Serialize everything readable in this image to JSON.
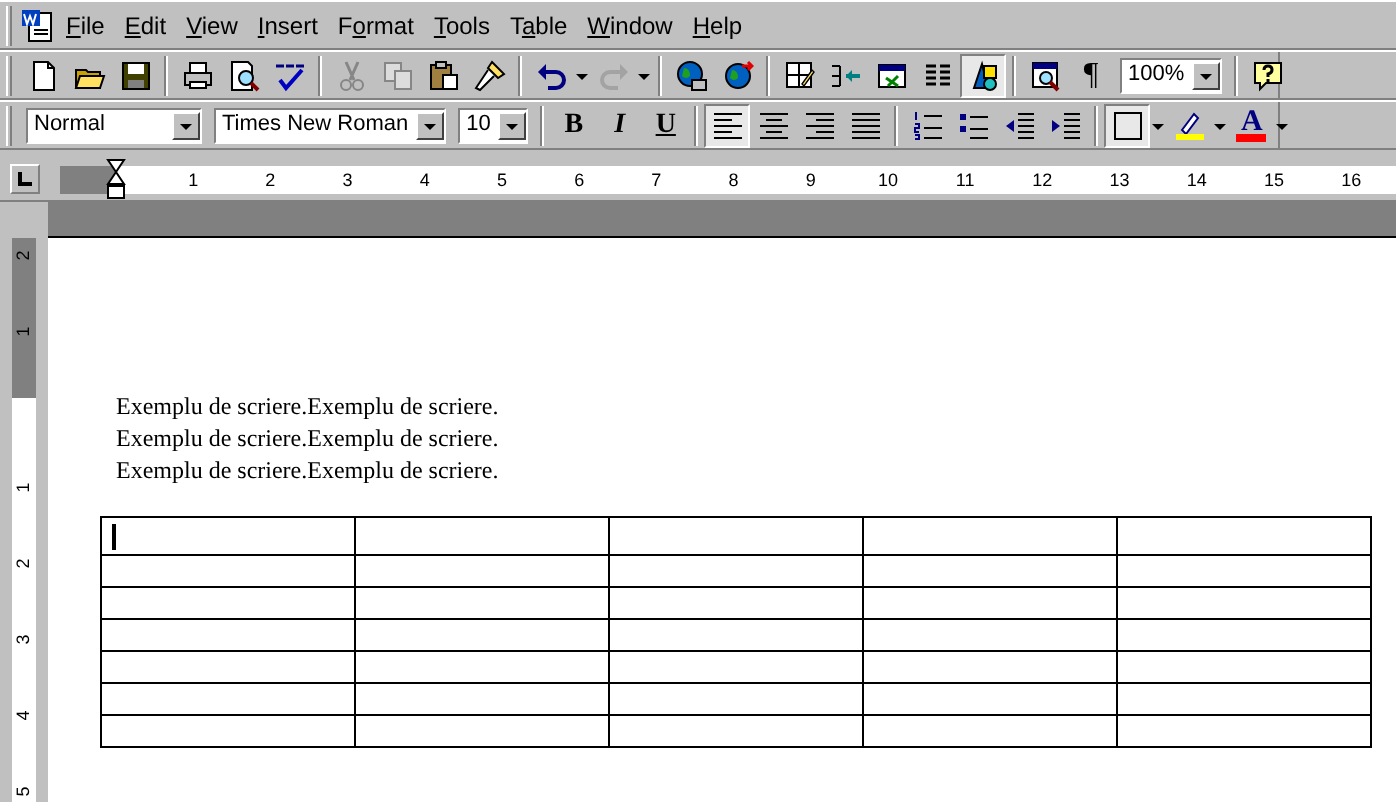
{
  "menu_bar": {
    "items": [
      {
        "access_key": "F",
        "rest": "ile"
      },
      {
        "access_key": "E",
        "rest": "dit"
      },
      {
        "access_key": "V",
        "rest": "iew"
      },
      {
        "access_key": "I",
        "rest": "nsert"
      },
      {
        "before": "F",
        "access_key": "o",
        "rest": "rmat"
      },
      {
        "access_key": "T",
        "rest": "ools"
      },
      {
        "before": "T",
        "access_key": "a",
        "rest": "ble"
      },
      {
        "access_key": "W",
        "rest": "indow"
      },
      {
        "access_key": "H",
        "rest": "elp"
      }
    ]
  },
  "standard_toolbar": {
    "items": [
      {
        "kind": "new",
        "disabled": false,
        "pressed": false
      },
      {
        "kind": "open",
        "disabled": false,
        "pressed": false
      },
      {
        "kind": "save",
        "disabled": false,
        "pressed": false
      },
      {
        "kind": "separator"
      },
      {
        "kind": "print",
        "disabled": false,
        "pressed": false
      },
      {
        "kind": "preview",
        "disabled": false,
        "pressed": false
      },
      {
        "kind": "spelling",
        "disabled": false,
        "pressed": false
      },
      {
        "kind": "separator"
      },
      {
        "kind": "cut",
        "disabled": true,
        "pressed": false
      },
      {
        "kind": "copy",
        "disabled": true,
        "pressed": false
      },
      {
        "kind": "paste",
        "disabled": false,
        "pressed": false
      },
      {
        "kind": "painter",
        "disabled": false,
        "pressed": false
      },
      {
        "kind": "separator"
      },
      {
        "kind": "undo",
        "disabled": false,
        "pressed": false
      },
      {
        "kind": "redo",
        "disabled": true,
        "pressed": false
      },
      {
        "kind": "separator"
      },
      {
        "kind": "globe",
        "disabled": false,
        "pressed": false
      },
      {
        "kind": "web",
        "disabled": false,
        "pressed": false
      },
      {
        "kind": "separator"
      },
      {
        "kind": "draw-table",
        "disabled": false,
        "pressed": false
      },
      {
        "kind": "insert-table",
        "disabled": false,
        "pressed": false
      },
      {
        "kind": "sheet",
        "disabled": false,
        "pressed": false
      },
      {
        "kind": "columns",
        "disabled": false,
        "pressed": false
      },
      {
        "kind": "drawing",
        "disabled": false,
        "pressed": true
      },
      {
        "kind": "separator"
      },
      {
        "kind": "doc-map",
        "disabled": false,
        "pressed": false
      },
      {
        "kind": "text",
        "label": "¶",
        "disabled": false,
        "pressed": false
      },
      {
        "kind": "combo",
        "value": "100%"
      },
      {
        "kind": "separator"
      },
      {
        "kind": "help",
        "disabled": false,
        "pressed": false
      }
    ]
  },
  "formatting_toolbar": {
    "items": [
      {
        "kind": "combo",
        "value": "Normal"
      },
      {
        "kind": "combo",
        "value": "Times New Roman"
      },
      {
        "kind": "combo",
        "value": "10"
      },
      {
        "kind": "separator"
      },
      {
        "kind": "bold",
        "label": "B",
        "pressed": false
      },
      {
        "kind": "italic",
        "label": "I",
        "pressed": false
      },
      {
        "kind": "underline",
        "label": "U",
        "pressed": false
      },
      {
        "kind": "separator"
      },
      {
        "kind": "align-left",
        "pressed": true
      },
      {
        "kind": "align-center",
        "pressed": false
      },
      {
        "kind": "align-right",
        "pressed": false
      },
      {
        "kind": "justify",
        "pressed": false
      },
      {
        "kind": "separator"
      },
      {
        "kind": "numbering",
        "pressed": false
      },
      {
        "kind": "bullets",
        "pressed": false
      },
      {
        "kind": "outdent",
        "pressed": false
      },
      {
        "kind": "indent",
        "pressed": false
      },
      {
        "kind": "separator"
      },
      {
        "kind": "border",
        "pressed": true
      },
      {
        "kind": "highlight",
        "pressed": false,
        "color": "#ffff00"
      },
      {
        "kind": "font-color",
        "label": "A",
        "pressed": false,
        "color": "#ff0000"
      }
    ]
  },
  "ruler": {
    "labels": [
      "1",
      "2",
      "3",
      "4",
      "5",
      "6",
      "7",
      "8",
      "9",
      "10",
      "11",
      "12",
      "13",
      "14",
      "15",
      "16"
    ]
  },
  "vertical_ruler": {
    "labels": [
      "2",
      "1",
      "1",
      "2",
      "3",
      "4",
      "5"
    ]
  },
  "document": {
    "paragraphs": [
      "Exemplu de scriere.Exemplu de scriere.",
      "Exemplu de scriere.Exemplu de scriere.",
      "Exemplu de scriere.Exemplu de scriere."
    ],
    "table": {
      "rows": [
        {
          "cells": [
            {
              "cursor": true
            },
            {
              "cursor": false
            },
            {
              "cursor": false
            },
            {
              "cursor": false
            },
            {
              "cursor": false
            }
          ]
        },
        {
          "cells": [
            {
              "cursor": false
            },
            {
              "cursor": false
            },
            {
              "cursor": false
            },
            {
              "cursor": false
            },
            {
              "cursor": false
            }
          ]
        },
        {
          "cells": [
            {
              "cursor": false
            },
            {
              "cursor": false
            },
            {
              "cursor": false
            },
            {
              "cursor": false
            },
            {
              "cursor": false
            }
          ]
        },
        {
          "cells": [
            {
              "cursor": false
            },
            {
              "cursor": false
            },
            {
              "cursor": false
            },
            {
              "cursor": false
            },
            {
              "cursor": false
            }
          ]
        },
        {
          "cells": [
            {
              "cursor": false
            },
            {
              "cursor": false
            },
            {
              "cursor": false
            },
            {
              "cursor": false
            },
            {
              "cursor": false
            }
          ]
        },
        {
          "cells": [
            {
              "cursor": false
            },
            {
              "cursor": false
            },
            {
              "cursor": false
            },
            {
              "cursor": false
            },
            {
              "cursor": false
            }
          ]
        },
        {
          "cells": [
            {
              "cursor": false
            },
            {
              "cursor": false
            },
            {
              "cursor": false
            },
            {
              "cursor": false
            },
            {
              "cursor": false
            }
          ]
        }
      ]
    }
  }
}
